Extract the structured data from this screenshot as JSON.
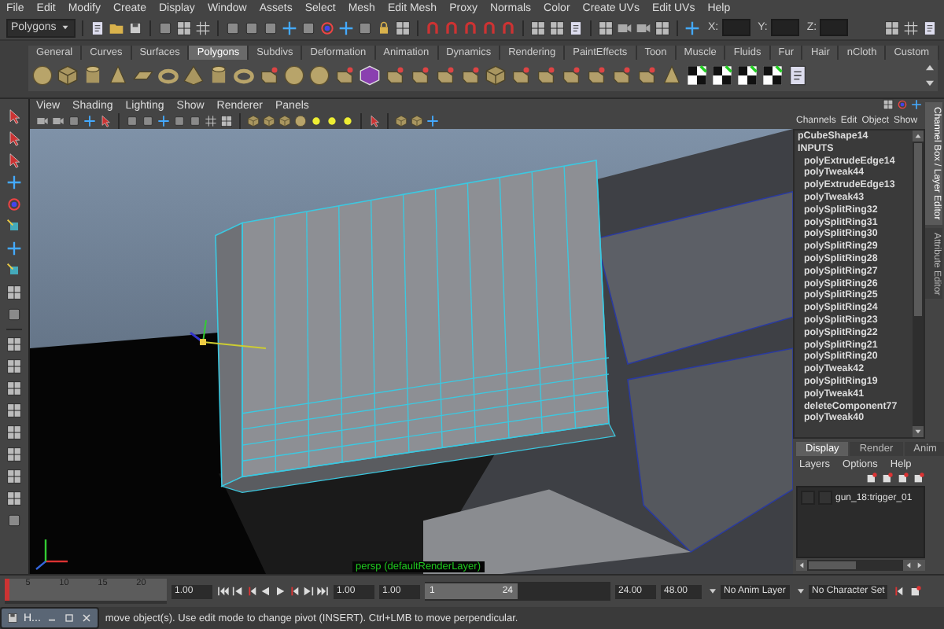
{
  "menu_bar": [
    "File",
    "Edit",
    "Modify",
    "Create",
    "Display",
    "Window",
    "Assets",
    "Select",
    "Mesh",
    "Edit Mesh",
    "Proxy",
    "Normals",
    "Color",
    "Create UVs",
    "Edit UVs",
    "Help"
  ],
  "status_line": {
    "mode": "Polygons",
    "coord_labels": [
      "X:",
      "Y:",
      "Z:"
    ]
  },
  "shelf": {
    "tabs": [
      {
        "label": "General",
        "selected": false
      },
      {
        "label": "Curves",
        "selected": false
      },
      {
        "label": "Surfaces",
        "selected": false
      },
      {
        "label": "Polygons",
        "selected": true
      },
      {
        "label": "Subdivs",
        "selected": false
      },
      {
        "label": "Deformation",
        "selected": false
      },
      {
        "label": "Animation",
        "selected": false
      },
      {
        "label": "Dynamics",
        "selected": false
      },
      {
        "label": "Rendering",
        "selected": false
      },
      {
        "label": "PaintEffects",
        "selected": false
      },
      {
        "label": "Toon",
        "selected": false
      },
      {
        "label": "Muscle",
        "selected": false
      },
      {
        "label": "Fluids",
        "selected": false
      },
      {
        "label": "Fur",
        "selected": false
      },
      {
        "label": "Hair",
        "selected": false
      },
      {
        "label": "nCloth",
        "selected": false
      },
      {
        "label": "Custom",
        "selected": false
      }
    ]
  },
  "viewport": {
    "menu": [
      "View",
      "Shading",
      "Lighting",
      "Show",
      "Renderer",
      "Panels"
    ],
    "camera_label": "persp (defaultRenderLayer)"
  },
  "channel_box": {
    "menu": [
      "Channels",
      "Edit",
      "Object",
      "Show"
    ],
    "object": "pCubeShape14",
    "section": "INPUTS",
    "inputs": [
      "polyExtrudeEdge14",
      "polyTweak44",
      "polyExtrudeEdge13",
      "polyTweak43",
      "polySplitRing32",
      "polySplitRing31",
      "polySplitRing30",
      "polySplitRing29",
      "polySplitRing28",
      "polySplitRing27",
      "polySplitRing26",
      "polySplitRing25",
      "polySplitRing24",
      "polySplitRing23",
      "polySplitRing22",
      "polySplitRing21",
      "polySplitRing20",
      "polyTweak42",
      "polySplitRing19",
      "polyTweak41",
      "deleteComponent77",
      "polyTweak40"
    ]
  },
  "side_tabs": [
    {
      "label": "Channel Box / Layer Editor",
      "selected": true
    },
    {
      "label": "Attribute Editor",
      "selected": false
    }
  ],
  "layer_editor": {
    "tabs": [
      {
        "label": "Display",
        "selected": true
      },
      {
        "label": "Render",
        "selected": false
      },
      {
        "label": "Anim",
        "selected": false
      }
    ],
    "menu": [
      "Layers",
      "Options",
      "Help"
    ],
    "layers": [
      {
        "name": "gun_18:trigger_01"
      }
    ]
  },
  "time_slider": {
    "ticks": [
      "5",
      "10",
      "15",
      "20"
    ],
    "current": "1.00",
    "level": 0.0
  },
  "range_slider": {
    "start": "1.00",
    "inner_start": "1.00",
    "handle_start": "1",
    "handle_end": "24",
    "level": 0.5,
    "inner_end": "24.00",
    "end": "48.00"
  },
  "anim_layer": "No Anim Layer",
  "character_set": "No Character Set",
  "minimized_window": {
    "title": "H..."
  },
  "help_line": "move object(s). Use edit mode to change pivot (INSERT).  Ctrl+LMB to move perpendicular."
}
